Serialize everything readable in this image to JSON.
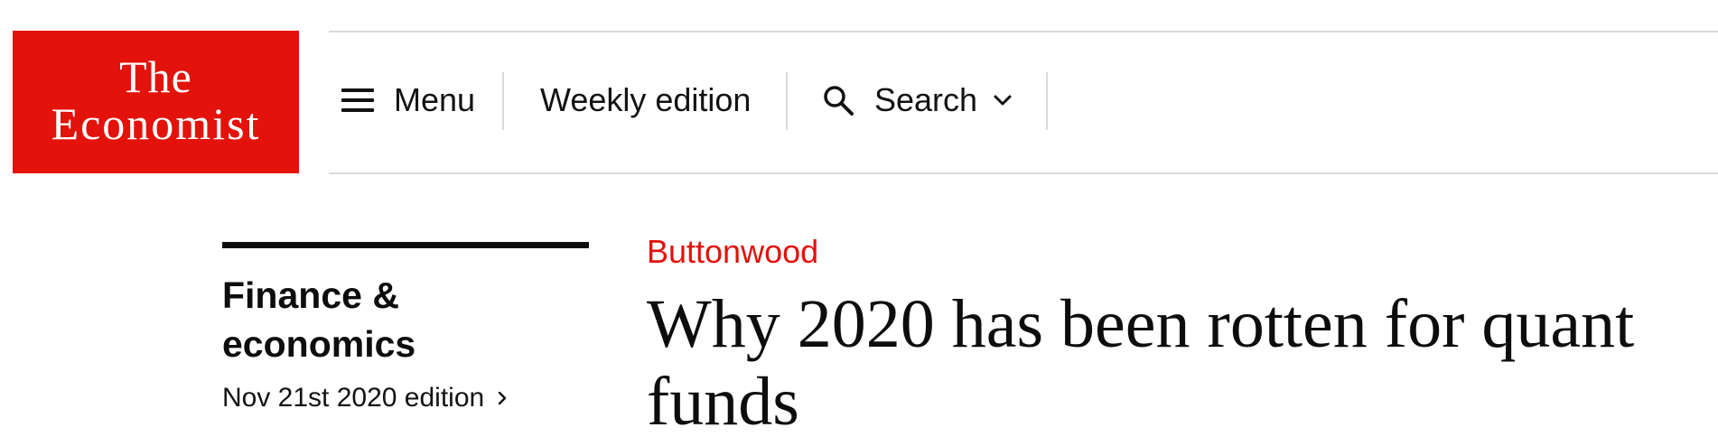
{
  "brand": {
    "line1": "The",
    "line2": "Economist",
    "color": "#e3120b"
  },
  "nav": {
    "menu_label": "Menu",
    "weekly_label": "Weekly edition",
    "search_label": "Search"
  },
  "icons": {
    "menu": "hamburger-icon",
    "search": "search-icon",
    "search_dropdown": "chevron-down-icon",
    "edition": "chevron-right-icon"
  },
  "section": {
    "title": "Finance & economics",
    "edition_label": "Nov 21st 2020 edition"
  },
  "article": {
    "rubric": "Buttonwood",
    "headline": "Why 2020 has been rotten for quant funds"
  },
  "colors": {
    "accent_red": "#e3120b",
    "text": "#0d0d0d",
    "divider": "#d9d9d9"
  }
}
